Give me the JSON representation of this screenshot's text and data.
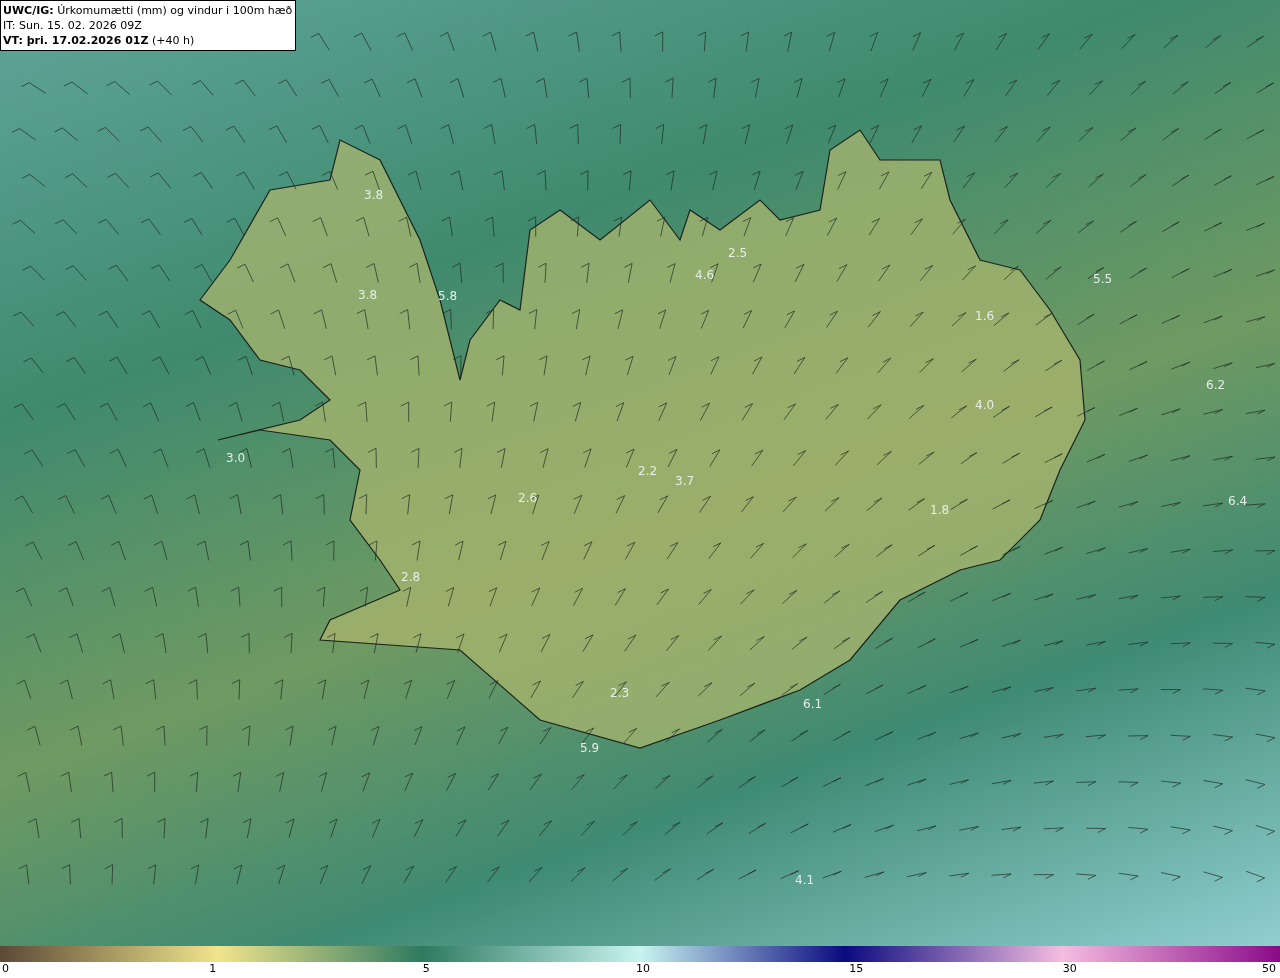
{
  "header": {
    "title": "**UWC/IG:** Úrkomumætti (mm) og vindur i 100m hæð",
    "issue_time": "IT: Sun. 15. 02. 2026 09Z",
    "valid_time": "**VT: þri. 17.02.2026 01Z** (+40 h)"
  },
  "map_labels": [
    "3.8",
    "3.8",
    "5.8",
    "4.6",
    "2.5",
    "5.5",
    "1.6",
    "4.0",
    "6.2",
    "3.0",
    "2.2",
    "3.7",
    "2.6",
    "1.8",
    "6.4",
    "2.8",
    "2.3",
    "6.1",
    "5.9",
    "4.1"
  ],
  "colorbar": {
    "ticks": [
      "0",
      "1",
      "5",
      "10",
      "15",
      "30",
      "50"
    ]
  }
}
